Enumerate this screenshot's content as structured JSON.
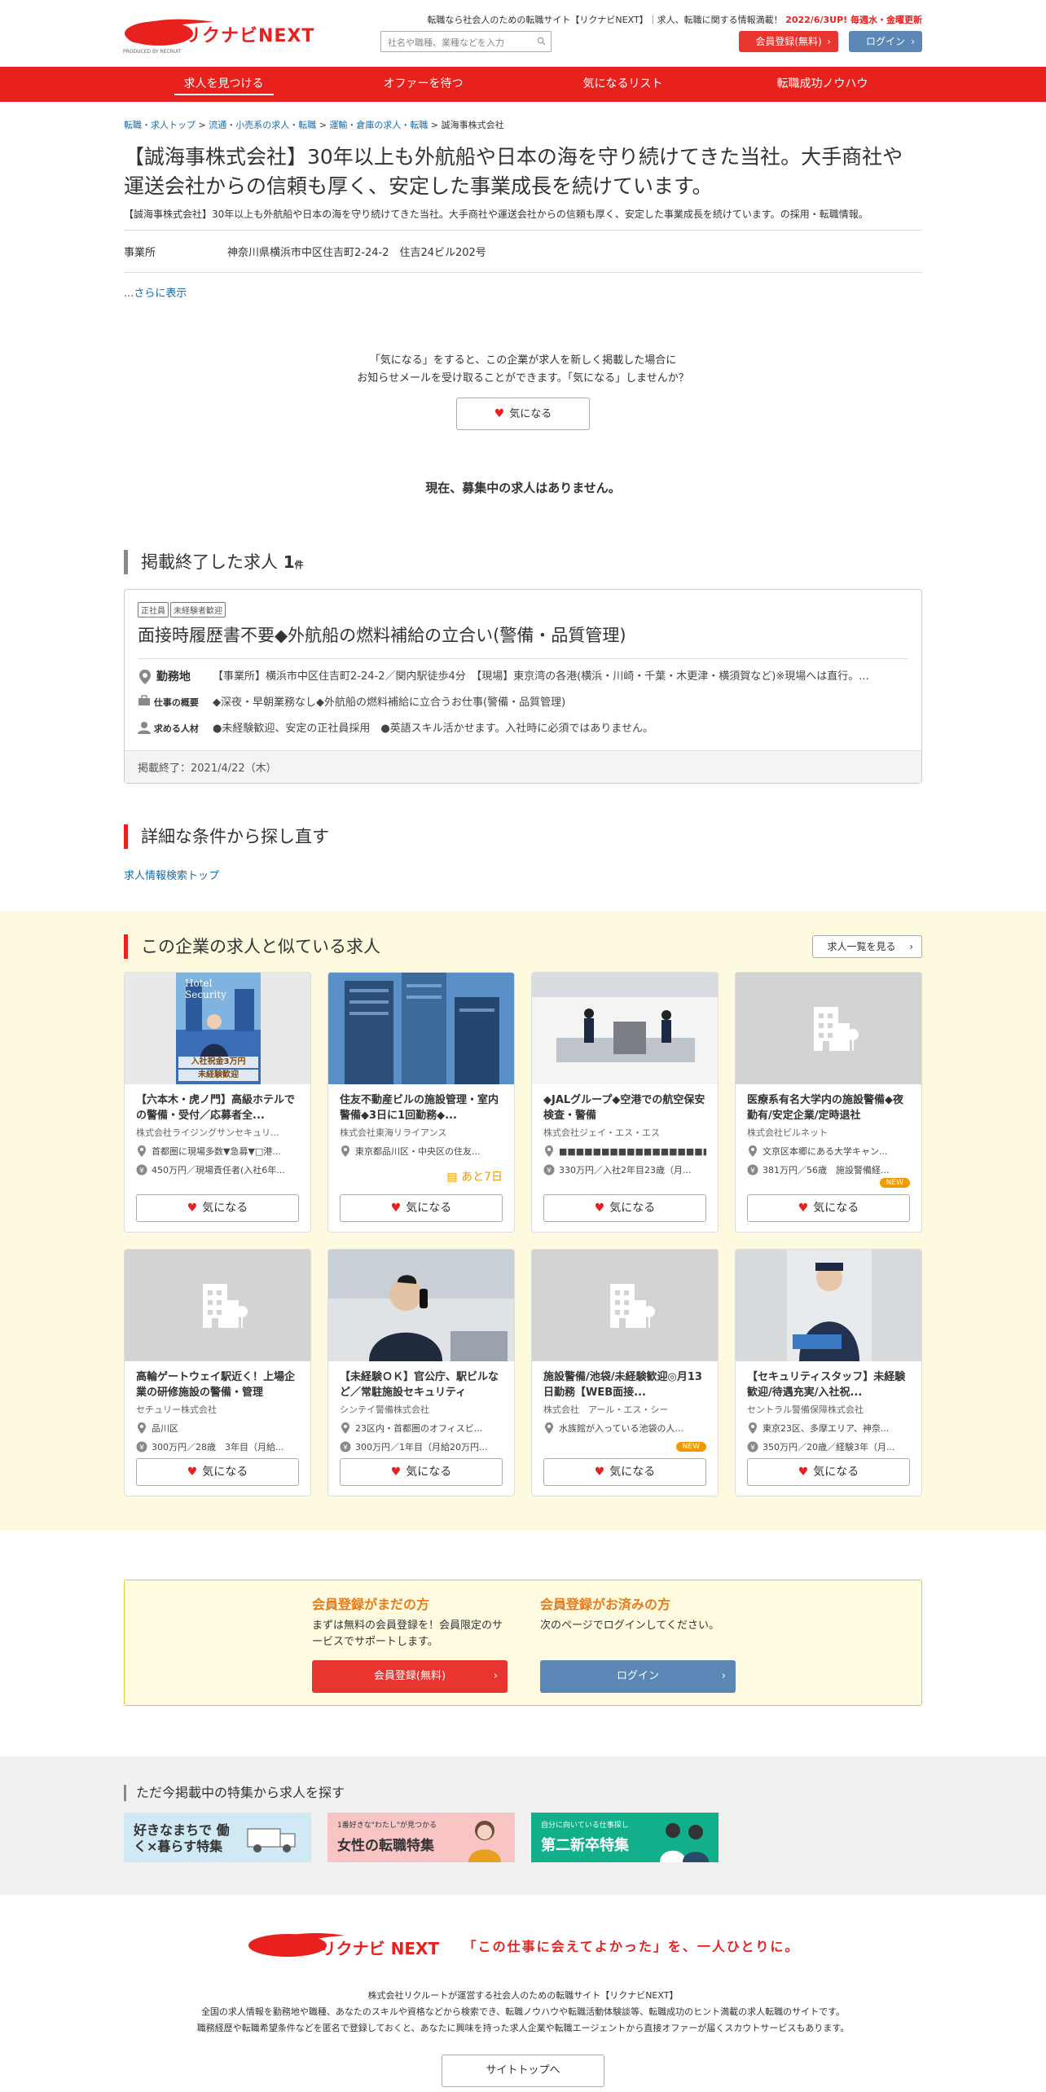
{
  "header": {
    "logo_main": "リクナビ",
    "logo_next": "NEXT",
    "logo_sub": "PRODUCED BY RECRUIT",
    "note": "転職なら社会人のための転職サイト【リクナビNEXT】｜求人、転職に関する情報満載！",
    "note_red": "2022/6/3UP! 毎週水・金曜更新",
    "search_placeholder": "社名や職種、業種などを入力",
    "register": "会員登録(無料)",
    "login": "ログイン"
  },
  "nav": [
    "求人を見つける",
    "オファーを待つ",
    "気になるリスト",
    "転職成功ノウハウ"
  ],
  "breadcrumb": [
    "転職・求人トップ",
    "流通・小売系の求人・転職",
    "運輸・倉庫の求人・転職",
    "誠海事株式会社"
  ],
  "company": {
    "title": "【誠海事株式会社】30年以上も外航船や日本の海を守り続けてきた当社。大手商社や運送会社からの信頼も厚く、安定した事業成長を続けています。",
    "desc": "【誠海事株式会社】30年以上も外航船や日本の海を守り続けてきた当社。大手商社や運送会社からの信頼も厚く、安定した事業成長を続けています。の採用・転職情報。",
    "office_label": "事業所",
    "office_value": "神奈川県横浜市中区住吉町2-24-2　住吉24ビル202号",
    "more": "...さらに表示"
  },
  "kininaru": {
    "text1": "「気になる」をすると、この企業が求人を新しく掲載した場合に",
    "text2": "お知らせメールを受け取ることができます。「気になる」しませんか？",
    "button": "気になる"
  },
  "no_jobs": "現在、募集中の求人はありません。",
  "ended": {
    "title": "掲載終了した求人",
    "count": "1",
    "unit": "件",
    "tags": [
      "正社員",
      "未経験者歓迎"
    ],
    "job_title": "面接時履歴書不要◆外航船の燃料補給の立合い(警備・品質管理)",
    "location_label": "勤務地",
    "location": "【事業所】横浜市中区住吉町2-24-2／関内駅徒歩4分　【現場】東京湾の各港(横浜・川崎・千葉・木更津・横須賀など)※現場へは直行。...",
    "work_label": "仕事の概要",
    "work": "◆深夜・早朝業務なし◆外航船の燃料補給に立合うお仕事(警備・品質管理)",
    "person_label": "求める人材",
    "person": "●未経験歓迎、安定の正社員採用　●英語スキル活かせます。入社時に必須ではありません。",
    "end_date": "掲載終了：2021/4/22（木）"
  },
  "research": {
    "title": "詳細な条件から探し直す",
    "link": "求人情報検索トップ"
  },
  "similar": {
    "title": "この企業の求人と似ている求人",
    "list_button": "求人一覧を見る",
    "fav": "気になる",
    "thumb_text1": "Hotel",
    "thumb_text2": "Security",
    "thumb_text3": "入社祝金3万円",
    "thumb_text4": "未経験歓迎",
    "cards": [
      {
        "title": "【六本木・虎ノ門】高級ホテルでの警備・受付／応募者全...",
        "company": "株式会社ライジングサンセキュリ...",
        "loc": "首都圏に現場多数▼急募▼□港...",
        "salary": "450万円／現場責任者(入社6年...",
        "badge": "",
        "thumb": "hotel"
      },
      {
        "title": "住友不動産ビルの施設管理・室内警備◆3日に1回勤務◆...",
        "company": "株式会社東海リライアンス",
        "loc": "東京都品川区・中央区の住友...",
        "salary": "",
        "badge": "あと7日",
        "thumb": "building"
      },
      {
        "title": "◆JALグループ◆空港での航空保安検査・警備",
        "company": "株式会社ジェイ・エス・エス",
        "loc": "■■■■■■■■■■■■■■■■■■～ご希...",
        "salary": "330万円／入社2年目23歳（月...",
        "badge": "",
        "thumb": "airport"
      },
      {
        "title": "医療系有名大学内の施設警備◆夜勤有/安定企業/定時退社",
        "company": "株式会社ビルネット",
        "loc": "文京区本郷にある大学キャン...",
        "salary": "381万円／56歳　施設警備経...",
        "badge": "NEW",
        "thumb": "none"
      },
      {
        "title": "高輪ゲートウェイ駅近く！上場企業の研修施設の警備・管理",
        "company": "セチュリー株式会社",
        "loc": "品川区",
        "salary": "300万円／28歳　3年目（月給...",
        "badge": "",
        "thumb": "none"
      },
      {
        "title": "【未経験ＯＫ】官公庁、駅ビルなど／常駐施設セキュリティ",
        "company": "シンテイ警備株式会社",
        "loc": "23区内・首都圏のオフィスビ...",
        "salary": "300万円／1年目（月給20万円...",
        "badge": "",
        "thumb": "phone"
      },
      {
        "title": "施設警備/池袋/未経験歓迎◎月13日勤務【WEB面接...",
        "company": "株式会社　アール・エス・シー",
        "loc": "水族館が入っている池袋の人...",
        "salary": "",
        "badge": "NEW",
        "thumb": "none"
      },
      {
        "title": "【セキュリティスタッフ】未経験歓迎/待遇充実/入社祝...",
        "company": "セントラル警備保障株式会社",
        "loc": "東京23区、多摩エリア、神奈...",
        "salary": "350万円／20歳／経験3年（月...",
        "badge": "",
        "thumb": "guard"
      }
    ]
  },
  "register_box": {
    "left_title": "会員登録がまだの方",
    "left_text": "まずは無料の会員登録を！会員限定のサービスでサポートします。",
    "left_button": "会員登録(無料)",
    "right_title": "会員登録がお済みの方",
    "right_text": "次のページでログインしてください。",
    "right_button": "ログイン"
  },
  "features": {
    "title": "ただ今掲載中の特集から求人を探す",
    "items": [
      "好きなまちで 働く×暮らす特集",
      "女性の転職特集",
      "第二新卒特集"
    ],
    "sub2": "1番好きな\"わたし\"が見つかる",
    "sub3": "自分に向いている仕事探し"
  },
  "footer": {
    "slogan": "「この仕事に会えてよかった」を、一人ひとりに。",
    "line1": "株式会社リクルートが運営する社会人のための転職サイト【リクナビNEXT】",
    "line2": "全国の求人情報を勤務地や職種、あなたのスキルや資格などから検索でき、転職ノウハウや転職活動体験談等、転職成功のヒント満載の求人転職のサイトです。",
    "line3": "職務経歴や転職希望条件などを匿名で登録しておくと、あなたに興味を持った求人企業や転職エージェントから直接オファーが届くスカウトサービスもあります。",
    "top_button": "サイトトップへ"
  },
  "colors": {
    "brand": "#e8211f",
    "login": "#5b86b6",
    "accent": "#f39800"
  }
}
